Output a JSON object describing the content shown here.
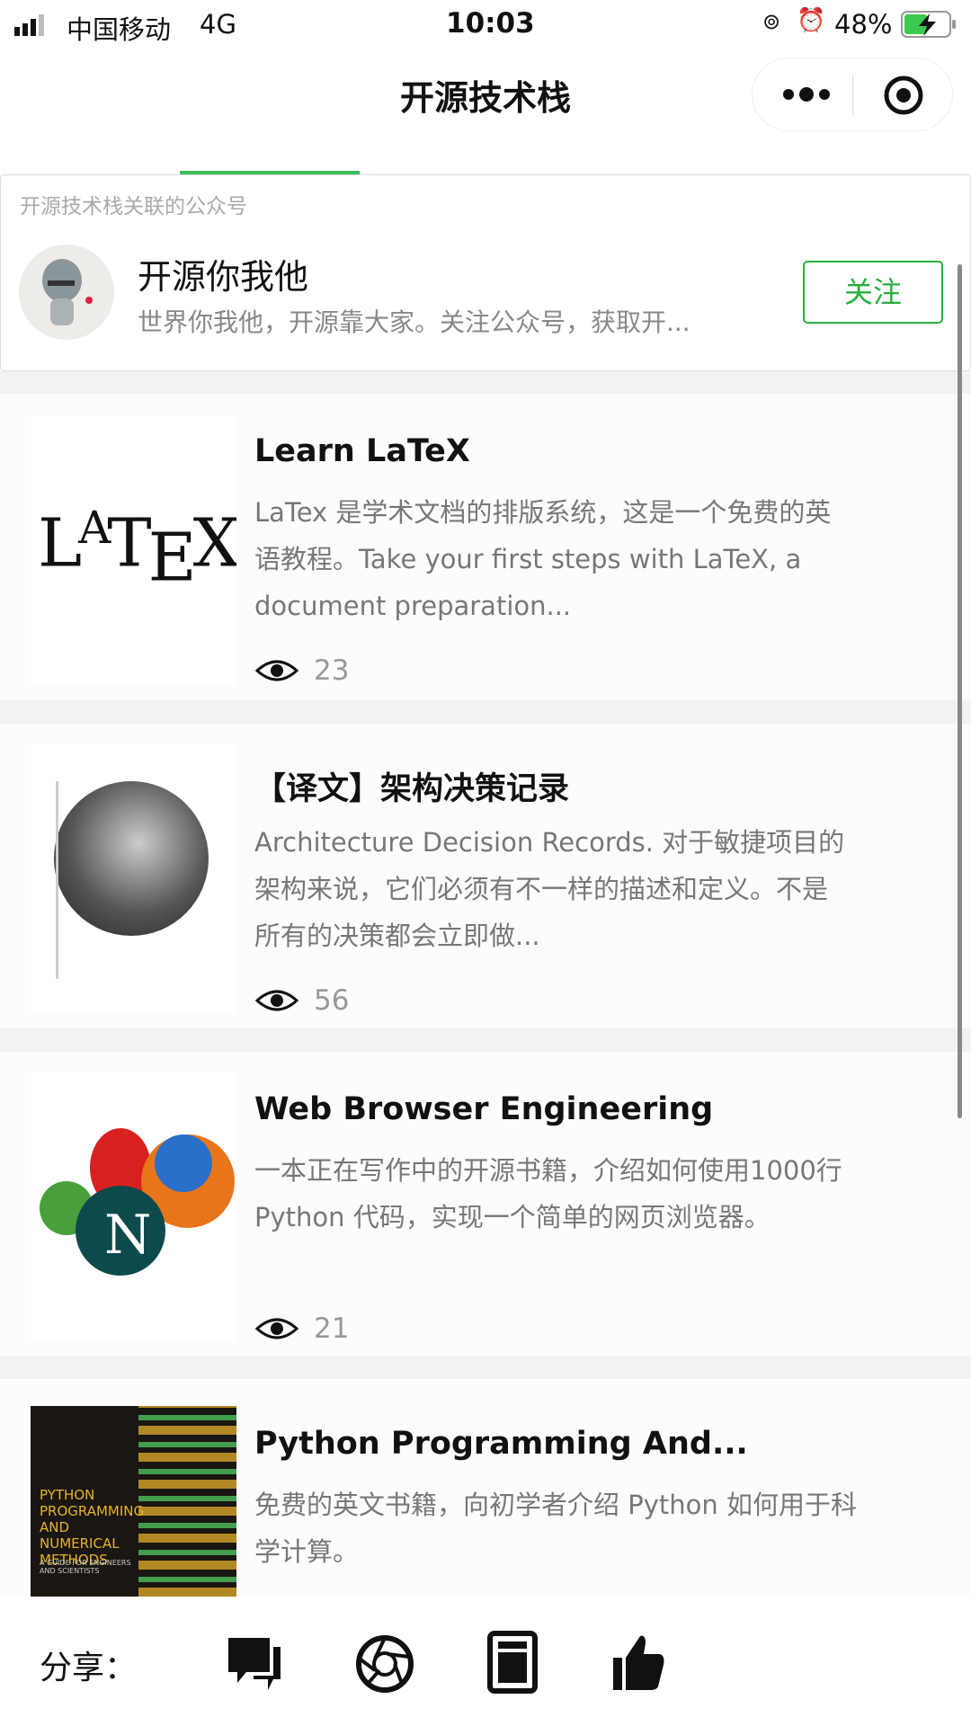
{
  "status_bar": {
    "carrier": "中国移动",
    "network": "4G",
    "time": "10:03",
    "battery": "48%"
  },
  "nav": {
    "title": "开源技术栈",
    "more_icon": "more-dots-icon",
    "close_icon": "target-circle-icon"
  },
  "account_card": {
    "label": "开源技术栈关联的公众号",
    "name": "开源你我他",
    "description": "世界你我他，开源靠大家。关注公众号，获取开...",
    "follow_label": "关注",
    "accent": "#2aae3e"
  },
  "articles": [
    {
      "title": "Learn LaTeX",
      "description": "LaTex 是学术文档的排版系统，这是一个免费的英语教程。Take your first steps with LaTeX, a document preparation...",
      "views": "23",
      "thumb_text": "LATEX"
    },
    {
      "title": "【译文】架构决策记录",
      "description": "Architecture Decision Records. 对于敏捷项目的架构来说，它们必须有不一样的描述和定义。不是所有的决策都会立即做...",
      "views": "56"
    },
    {
      "title": "Web Browser Engineering",
      "description": "一本正在写作中的开源书籍，介绍如何使用1000行 Python 代码，实现一个简单的网页浏览器。",
      "views": "21",
      "thumb_text": "N"
    },
    {
      "title": "Python Programming And...",
      "description": "免费的英文书籍，向初学者介绍 Python 如何用于科学计算。",
      "thumb_text": "PYTHON PROGRAMMING AND NUMERICAL METHODS",
      "thumb_sub": "A GUIDE FOR ENGINEERS AND SCIENTISTS"
    }
  ],
  "share": {
    "label": "分享：",
    "icons": [
      "chat-bubbles-icon",
      "aperture-icon",
      "tablet-icon",
      "thumbs-up-icon"
    ]
  }
}
